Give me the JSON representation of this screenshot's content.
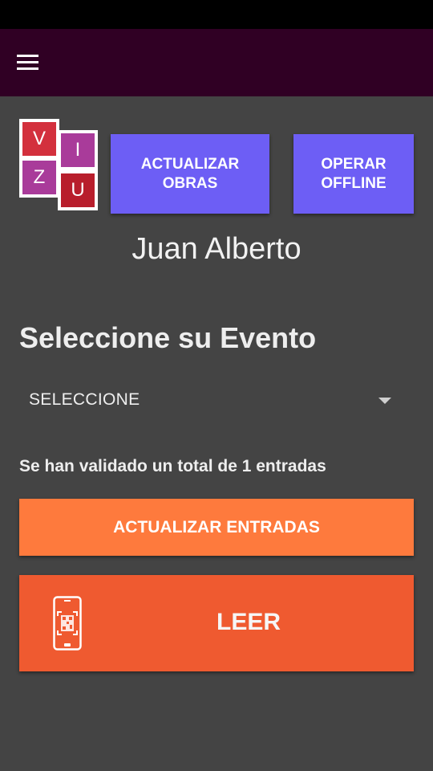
{
  "status_bar": {
    "color": "#000000"
  },
  "app_bar": {
    "background": "#300024",
    "menu_icon": "hamburger-menu-icon"
  },
  "logo": {
    "tiles": [
      {
        "letter": "V",
        "color": "#d3303d"
      },
      {
        "letter": "I",
        "color": "#a93b9a"
      },
      {
        "letter": "Z",
        "color": "#a93b9a"
      },
      {
        "letter": "U",
        "color": "#b81e2c"
      }
    ]
  },
  "buttons": {
    "actualizar_obras": {
      "line1": "ACTUALIZAR",
      "line2": "OBRAS",
      "color": "#6d5ef5"
    },
    "operar_offline": {
      "line1": "OPERAR",
      "line2": "OFFLINE",
      "color": "#6d5ef5"
    },
    "actualizar_entradas": {
      "label": "ACTUALIZAR ENTRADAS",
      "color": "#fe7a3d"
    },
    "leer": {
      "label": "LEER",
      "icon": "phone-qr-scan-icon",
      "color": "#ef5a30"
    }
  },
  "user": {
    "name": "Juan Alberto"
  },
  "event_section": {
    "title": "Seleccione su Evento",
    "select_value": "SELECCIONE"
  },
  "validation": {
    "text": "Se han validado un total de 1 entradas"
  }
}
